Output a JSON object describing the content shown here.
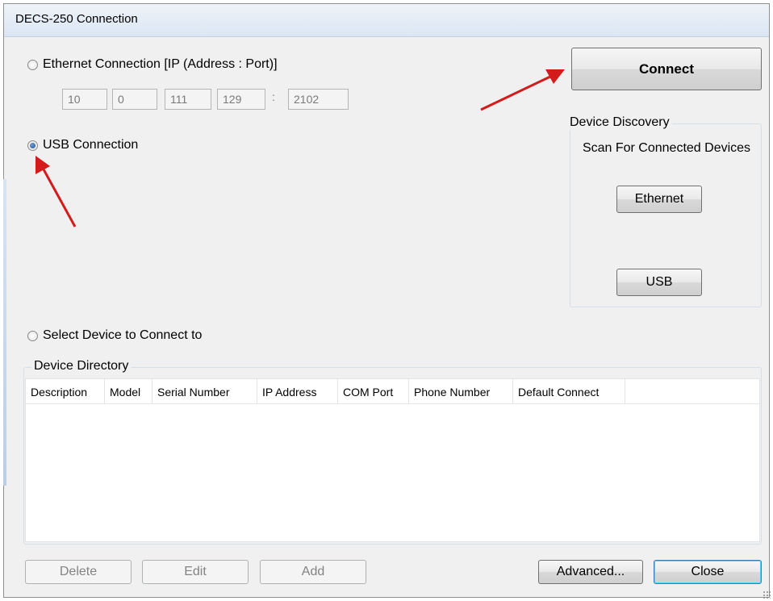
{
  "window": {
    "title": "DECS-250 Connection"
  },
  "ethernet": {
    "label": "Ethernet Connection [IP (Address : Port)]",
    "ip": [
      "10",
      "0",
      "111",
      "129"
    ],
    "separator": ":",
    "port": "2102"
  },
  "usb": {
    "label": "USB Connection"
  },
  "connect_button": "Connect",
  "discovery": {
    "legend": "Device Discovery",
    "text": "Scan For Connected Devices",
    "ethernet_button": "Ethernet",
    "usb_button": "USB"
  },
  "select_device": {
    "label": "Select Device to Connect to"
  },
  "directory": {
    "legend": "Device Directory",
    "columns": [
      "Description",
      "Model",
      "Serial Number",
      "IP Address",
      "COM Port",
      "Phone Number",
      "Default Connect"
    ]
  },
  "footer": {
    "delete": "Delete",
    "edit": "Edit",
    "add": "Add",
    "advanced": "Advanced...",
    "close": "Close"
  },
  "annotation_color": "#d31b1b"
}
